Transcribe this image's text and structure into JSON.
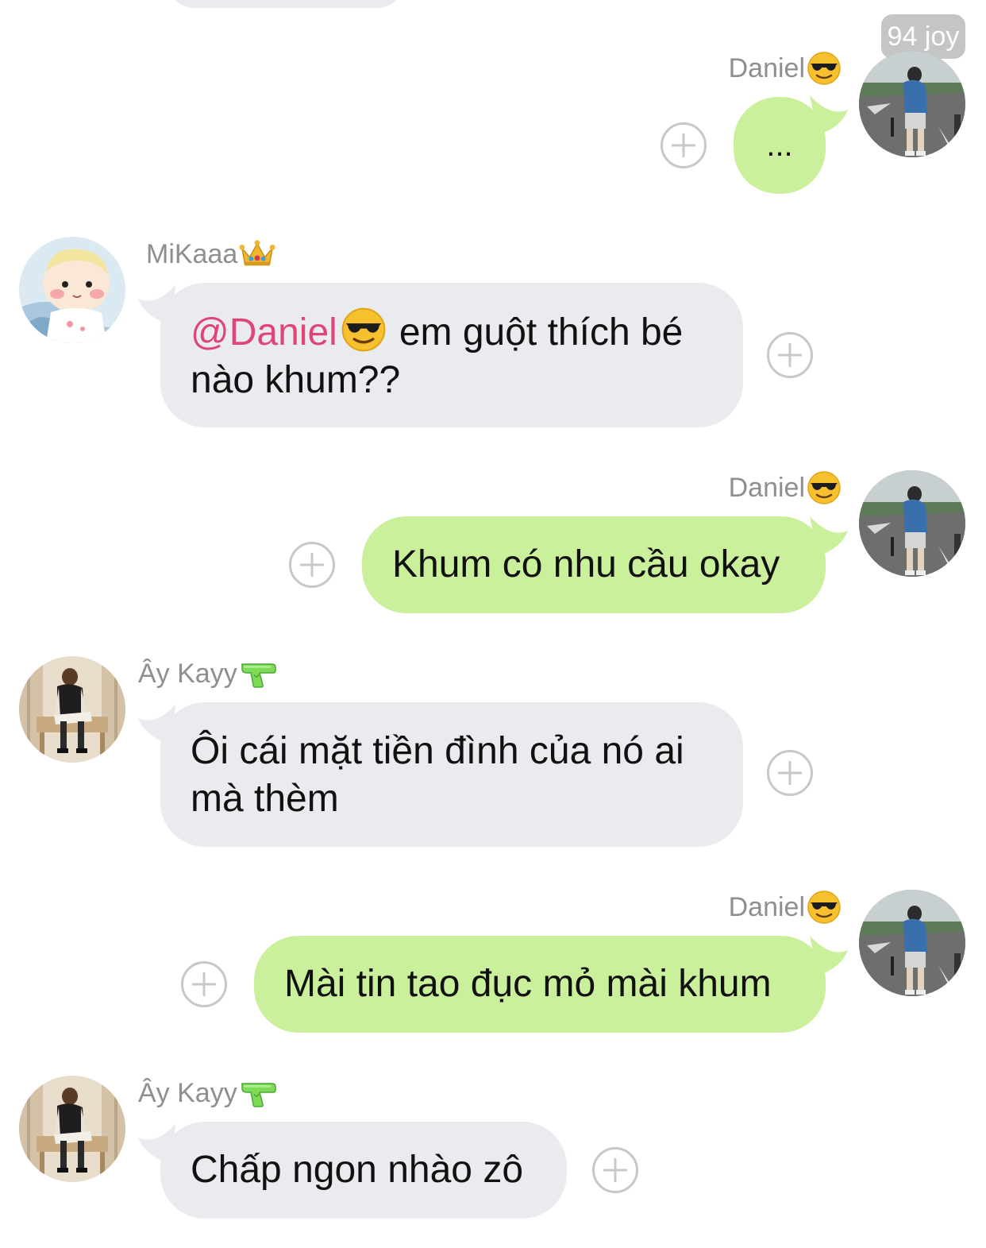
{
  "watermark": "94 joy",
  "messages": [
    {
      "id": "m1",
      "direction": "out",
      "sender": "Daniel",
      "sender_emoji": "sunglasses-emoji",
      "text": "...",
      "mention": ""
    },
    {
      "id": "m2",
      "direction": "in",
      "sender": "MiKaaa",
      "sender_emoji": "crown-emoji",
      "mention": "@Daniel",
      "mention_emoji": "sunglasses-emoji",
      "text_line1": "em guột thích bé",
      "text_line2": "nào khum??"
    },
    {
      "id": "m3",
      "direction": "out",
      "sender": "Daniel",
      "sender_emoji": "sunglasses-emoji",
      "text": "Khum có nhu cầu okay"
    },
    {
      "id": "m4",
      "direction": "in",
      "sender": "Ây Kayy",
      "sender_emoji": "water-pistol-emoji",
      "text_line1": "Ôi cái mặt tiền đình của nó ai",
      "text_line2": "mà thèm"
    },
    {
      "id": "m5",
      "direction": "out",
      "sender": "Daniel",
      "sender_emoji": "sunglasses-emoji",
      "text": "Mài tin tao đục mỏ mài khum"
    },
    {
      "id": "m6",
      "direction": "in",
      "sender": "Ây Kayy",
      "sender_emoji": "water-pistol-emoji",
      "text": "Chấp ngon nhào zô"
    }
  ],
  "colors": {
    "incoming_bubble": "#e9ebee",
    "outgoing_bubble": "#cbf09c",
    "mention": "#e0457a",
    "name": "#8e8e93",
    "plus_icon": "#c7c7cc"
  }
}
